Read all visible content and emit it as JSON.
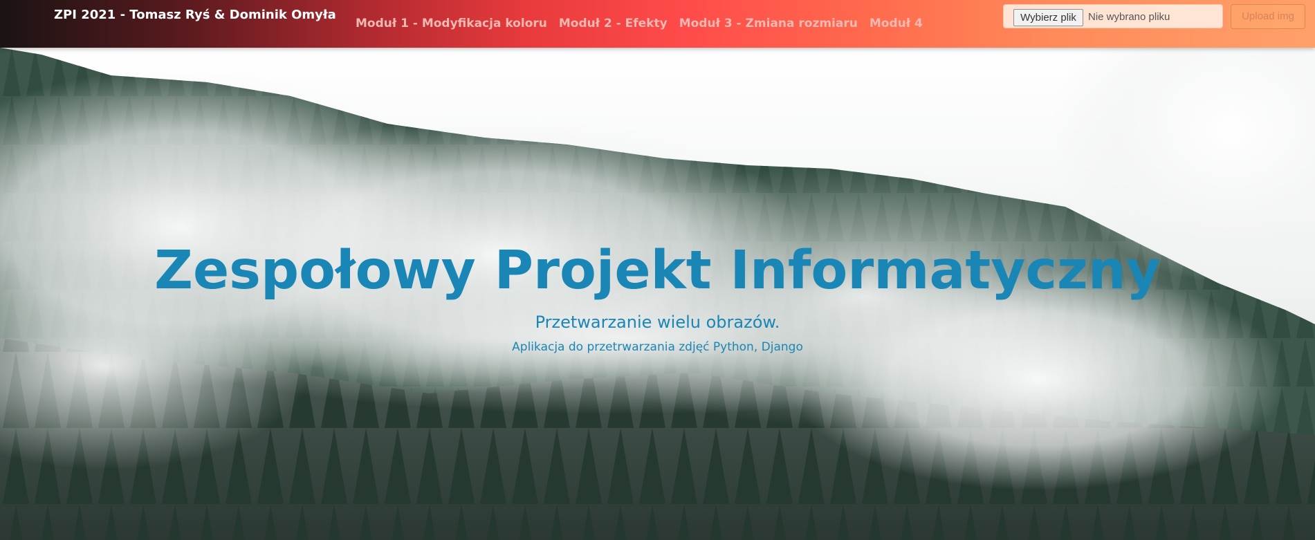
{
  "navbar": {
    "brand": "ZPI 2021 - Tomasz Ryś & Dominik Omyła",
    "links": [
      "Moduł 1 - Modyfikacja koloru",
      "Moduł 2 - Efekty",
      "Moduł 3 - Zmiana rozmiaru",
      "Moduł 4"
    ],
    "upload": {
      "file_button_label": "Wybierz plik",
      "file_status": "Nie wybrano pliku",
      "submit_label": "Upload img"
    }
  },
  "hero": {
    "title": "Zespołowy Projekt Informatyczny",
    "subtitle": "Przetwarzanie wielu obrazów.",
    "caption": "Aplikacja do przetrwarzania zdjęć Python, Django",
    "background_image": "misty-pine-forest"
  },
  "colors": {
    "accent_text": "#1a86b5",
    "nav_link": "#f2b8b2",
    "nav_gradient_start": "#1a1313",
    "nav_gradient_mid": "#ff4b4a",
    "nav_gradient_end": "#ffa06a"
  }
}
